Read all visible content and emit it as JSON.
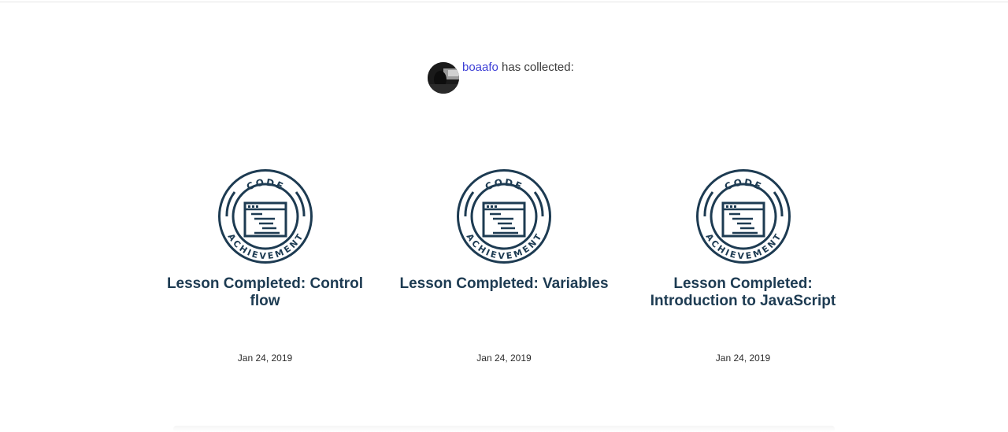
{
  "collector": {
    "username": "boaafo",
    "suffix": " has collected:"
  },
  "colors": {
    "badge": "#1d3b52",
    "link": "#3d3fd6"
  },
  "badges": [
    {
      "icon": "code-achievement-icon",
      "top_text": "CODE",
      "bottom_text": "ACHIEVEMENT",
      "title": "Lesson Completed: Control flow",
      "date": "Jan 24, 2019"
    },
    {
      "icon": "code-achievement-icon",
      "top_text": "CODE",
      "bottom_text": "ACHIEVEMENT",
      "title": "Lesson Completed: Variables",
      "date": "Jan 24, 2019"
    },
    {
      "icon": "code-achievement-icon",
      "top_text": "CODE",
      "bottom_text": "ACHIEVEMENT",
      "title": "Lesson Completed: Introduction to JavaScript",
      "date": "Jan 24, 2019"
    }
  ]
}
